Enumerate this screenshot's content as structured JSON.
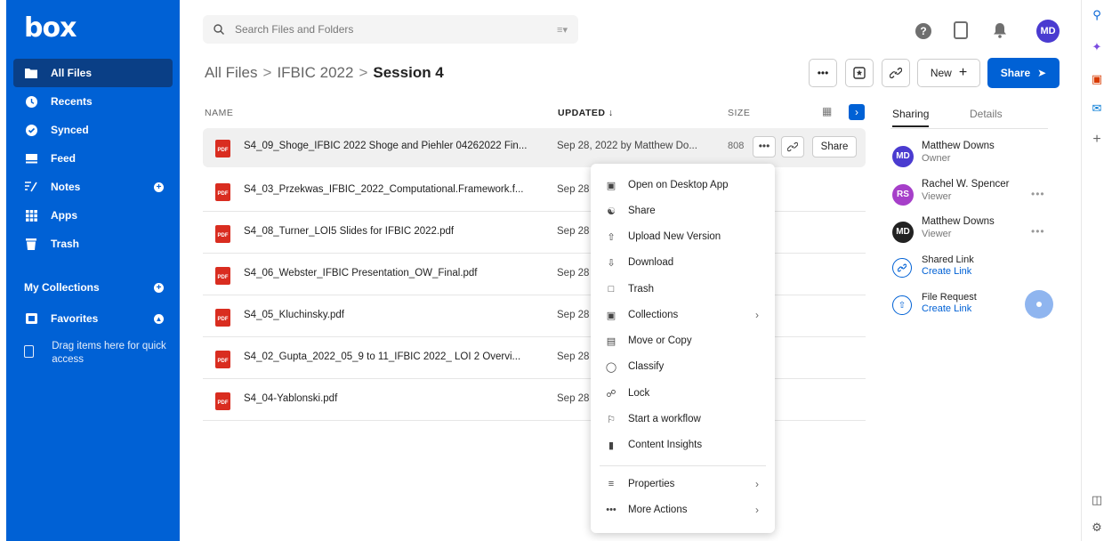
{
  "sidebar": {
    "logo": "box",
    "items": [
      {
        "label": "All Files",
        "icon": "folder-icon"
      },
      {
        "label": "Recents",
        "icon": "clock-icon"
      },
      {
        "label": "Synced",
        "icon": "check-circle-icon"
      },
      {
        "label": "Feed",
        "icon": "feed-icon"
      },
      {
        "label": "Notes",
        "icon": "notes-icon"
      },
      {
        "label": "Apps",
        "icon": "grid-icon"
      },
      {
        "label": "Trash",
        "icon": "trash-icon"
      }
    ],
    "collections_label": "My Collections",
    "favorites_label": "Favorites",
    "drag_hint": "Drag items here for quick access"
  },
  "search": {
    "placeholder": "Search Files and Folders"
  },
  "header": {
    "avatar_initials": "MD",
    "breadcrumb": [
      "All Files",
      "IFBIC 2022",
      "Session 4"
    ],
    "new_label": "New",
    "share_label": "Share"
  },
  "table": {
    "headers": {
      "name": "NAME",
      "updated": "UPDATED",
      "size": "SIZE"
    },
    "rows": [
      {
        "name": "S4_09_Shoge_IFBIC 2022 Shoge and Piehler 04262022 Fin...",
        "updated": "Sep 28, 2022 by Matthew Do...",
        "size": "808"
      },
      {
        "name": "S4_03_Przekwas_IFBIC_2022_Computational.Framework.f...",
        "updated": "Sep 28",
        "size": ""
      },
      {
        "name": "S4_08_Turner_LOI5 Slides for IFBIC 2022.pdf",
        "updated": "Sep 28",
        "size": ""
      },
      {
        "name": "S4_06_Webster_IFBIC Presentation_OW_Final.pdf",
        "updated": "Sep 28",
        "size": ""
      },
      {
        "name": "S4_05_Kluchinsky.pdf",
        "updated": "Sep 28",
        "size": ""
      },
      {
        "name": "S4_02_Gupta_2022_05_9 to 11_IFBIC 2022_ LOI 2 Overvi...",
        "updated": "Sep 28",
        "size": ""
      },
      {
        "name": "S4_04-Yablonski.pdf",
        "updated": "Sep 28",
        "size": ""
      }
    ],
    "row_share_label": "Share",
    "file_badge": "PDF"
  },
  "context_menu": {
    "items": [
      {
        "label": "Open on Desktop App",
        "icon": "desktop-app-icon"
      },
      {
        "label": "Share",
        "icon": "share-icon"
      },
      {
        "label": "Upload New Version",
        "icon": "upload-icon"
      },
      {
        "label": "Download",
        "icon": "download-icon"
      },
      {
        "label": "Trash",
        "icon": "trash-icon"
      },
      {
        "label": "Collections",
        "icon": "collections-icon",
        "submenu": true
      },
      {
        "label": "Move or Copy",
        "icon": "move-copy-icon"
      },
      {
        "label": "Classify",
        "icon": "shield-icon"
      },
      {
        "label": "Lock",
        "icon": "lock-icon"
      },
      {
        "label": "Start a workflow",
        "icon": "workflow-icon"
      },
      {
        "label": "Content Insights",
        "icon": "insights-icon"
      },
      {
        "label": "Properties",
        "icon": "properties-icon",
        "submenu": true
      },
      {
        "label": "More Actions",
        "icon": "more-icon",
        "submenu": true
      }
    ]
  },
  "details_panel": {
    "tabs": [
      "Sharing",
      "Details"
    ],
    "people": [
      {
        "initials": "MD",
        "name": "Matthew Downs",
        "role": "Owner",
        "color": "#4a3bd0"
      },
      {
        "initials": "RS",
        "name": "Rachel W. Spencer",
        "role": "Viewer",
        "color": "#a63fc9"
      },
      {
        "initials": "MD",
        "name": "Matthew Downs",
        "role": "Viewer",
        "color": "#222222"
      }
    ],
    "shared_link": {
      "title": "Shared Link",
      "action": "Create Link"
    },
    "file_request": {
      "title": "File Request",
      "action": "Create Link"
    }
  },
  "colors": {
    "brand": "#0061d5",
    "pdf": "#d92d20"
  }
}
